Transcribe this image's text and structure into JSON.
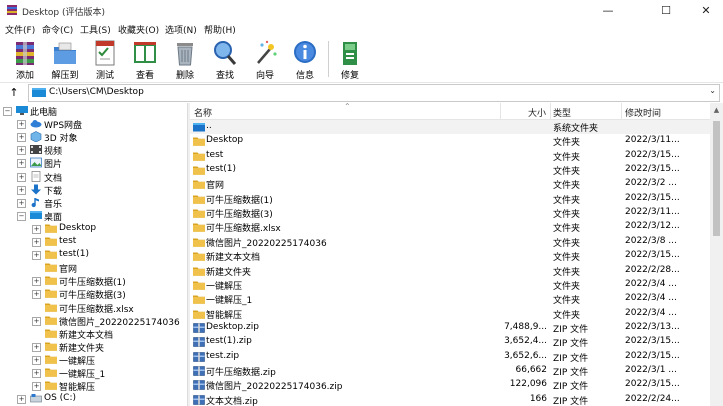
{
  "window": {
    "title": "Desktop (评估版本)",
    "minimize": "—",
    "maximize": "☐",
    "close": "✕"
  },
  "menu": [
    {
      "label": "文件(F)"
    },
    {
      "label": "命令(C)"
    },
    {
      "label": "工具(S)"
    },
    {
      "label": "收藏夹(O)"
    },
    {
      "label": "选项(N)"
    },
    {
      "label": "帮助(H)"
    }
  ],
  "toolbar": {
    "add": "添加",
    "extract": "解压到",
    "test": "测试",
    "view": "查看",
    "delete": "删除",
    "find": "查找",
    "wizard": "向导",
    "info": "信息",
    "repair": "修复"
  },
  "address": {
    "up": "↑",
    "path": "C:\\Users\\CM\\Desktop",
    "dropdown": "⌄"
  },
  "tree": {
    "items": [
      {
        "label": "此电脑"
      },
      {
        "label": "WPS网盘"
      },
      {
        "label": "3D 对象"
      },
      {
        "label": "视频"
      },
      {
        "label": "图片"
      },
      {
        "label": "文档"
      },
      {
        "label": "下载"
      },
      {
        "label": "音乐"
      },
      {
        "label": "桌面"
      },
      {
        "label": "Desktop"
      },
      {
        "label": "test"
      },
      {
        "label": "test(1)"
      },
      {
        "label": "官网"
      },
      {
        "label": "可牛压缩数据(1)"
      },
      {
        "label": "可牛压缩数据(3)"
      },
      {
        "label": "可牛压缩数据.xlsx"
      },
      {
        "label": "微信图片_20220225174036"
      },
      {
        "label": "新建文本文档"
      },
      {
        "label": "新建文件夹"
      },
      {
        "label": "一键解压"
      },
      {
        "label": "一键解压_1"
      },
      {
        "label": "智能解压"
      },
      {
        "label": "OS (C:)"
      }
    ]
  },
  "filelist": {
    "columns": {
      "name": "名称",
      "size": "大小",
      "type": "类型",
      "modified": "修改时间"
    },
    "rows": [
      {
        "name": "..",
        "size": "",
        "type": "系统文件夹",
        "modified": ""
      },
      {
        "name": "Desktop",
        "size": "",
        "type": "文件夹",
        "modified": "2022/3/11..."
      },
      {
        "name": "test",
        "size": "",
        "type": "文件夹",
        "modified": "2022/3/15..."
      },
      {
        "name": "test(1)",
        "size": "",
        "type": "文件夹",
        "modified": "2022/3/15..."
      },
      {
        "name": "官网",
        "size": "",
        "type": "文件夹",
        "modified": "2022/3/2 ..."
      },
      {
        "name": "可牛压缩数据(1)",
        "size": "",
        "type": "文件夹",
        "modified": "2022/3/15..."
      },
      {
        "name": "可牛压缩数据(3)",
        "size": "",
        "type": "文件夹",
        "modified": "2022/3/11..."
      },
      {
        "name": "可牛压缩数据.xlsx",
        "size": "",
        "type": "文件夹",
        "modified": "2022/3/12..."
      },
      {
        "name": "微信图片_20220225174036",
        "size": "",
        "type": "文件夹",
        "modified": "2022/3/8 ..."
      },
      {
        "name": "新建文本文档",
        "size": "",
        "type": "文件夹",
        "modified": "2022/3/15..."
      },
      {
        "name": "新建文件夹",
        "size": "",
        "type": "文件夹",
        "modified": "2022/2/28..."
      },
      {
        "name": "一键解压",
        "size": "",
        "type": "文件夹",
        "modified": "2022/3/4 ..."
      },
      {
        "name": "一键解压_1",
        "size": "",
        "type": "文件夹",
        "modified": "2022/3/4 ..."
      },
      {
        "name": "智能解压",
        "size": "",
        "type": "文件夹",
        "modified": "2022/3/4 ..."
      },
      {
        "name": "Desktop.zip",
        "size": "7,488,9...",
        "type": "ZIP 文件",
        "modified": "2022/3/13..."
      },
      {
        "name": "test(1).zip",
        "size": "3,652,4...",
        "type": "ZIP 文件",
        "modified": "2022/3/15..."
      },
      {
        "name": "test.zip",
        "size": "3,652,6...",
        "type": "ZIP 文件",
        "modified": "2022/3/15..."
      },
      {
        "name": "可牛压缩数据.zip",
        "size": "66,662",
        "type": "ZIP 文件",
        "modified": "2022/3/1 ..."
      },
      {
        "name": "微信图片_20220225174036.zip",
        "size": "122,096",
        "type": "ZIP 文件",
        "modified": "2022/3/15..."
      },
      {
        "name": "文本文档.zip",
        "size": "166",
        "type": "ZIP 文件",
        "modified": "2022/2/24..."
      }
    ]
  },
  "colors": {
    "folder": "#f0c24b",
    "folder_dark": "#d9a520",
    "zip": "#3f6fb5",
    "accent": "#1a73c9"
  }
}
